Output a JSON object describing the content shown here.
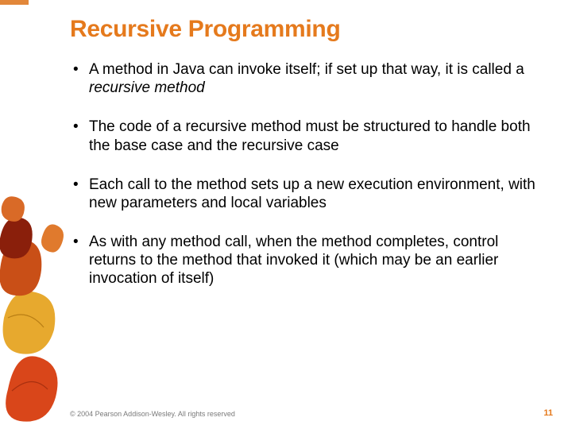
{
  "title": "Recursive Programming",
  "bullets": [
    {
      "pre": "A method in Java can invoke itself;  if set up that way, it is called a ",
      "em": "recursive method",
      "post": ""
    },
    {
      "pre": "The code of a recursive method must be structured to handle both the base case and the recursive case",
      "em": "",
      "post": ""
    },
    {
      "pre": "Each call to the method sets up a new execution environment, with new parameters and local variables",
      "em": "",
      "post": ""
    },
    {
      "pre": "As with any method call, when the method completes, control returns to the method that invoked it (which may be an earlier invocation of itself)",
      "em": "",
      "post": ""
    }
  ],
  "footer": {
    "copyright": "© 2004 Pearson Addison-Wesley. All rights reserved",
    "page": "11"
  }
}
